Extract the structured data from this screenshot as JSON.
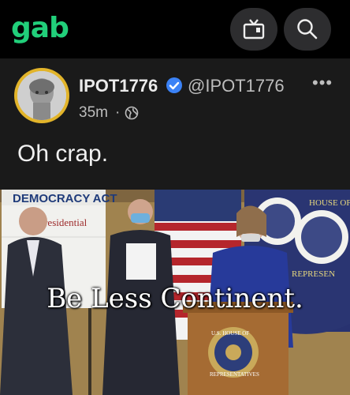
{
  "header": {
    "logo": "gab",
    "tv_icon": "tv-icon",
    "search_icon": "search-icon",
    "accent": "#21cf7a"
  },
  "post": {
    "display_name": "IPOT1776",
    "handle": "@IPOT1776",
    "timestamp": "35m",
    "separator": "·",
    "visibility_icon": "globe-icon",
    "verified_icon": "verified-badge-icon",
    "more_label": "•••",
    "text": "Oh crap."
  },
  "media": {
    "caption": "Be Less Continent.",
    "sign_text": "DEMOCRACY ACT",
    "sign_sub": "t Presidential",
    "seal_top": "HOUSE OF",
    "seal_side": "REPRESEN",
    "podium_seal_top": "U.S. HOUSE OF",
    "podium_seal_bottom": "REPRESENTATIVES"
  }
}
